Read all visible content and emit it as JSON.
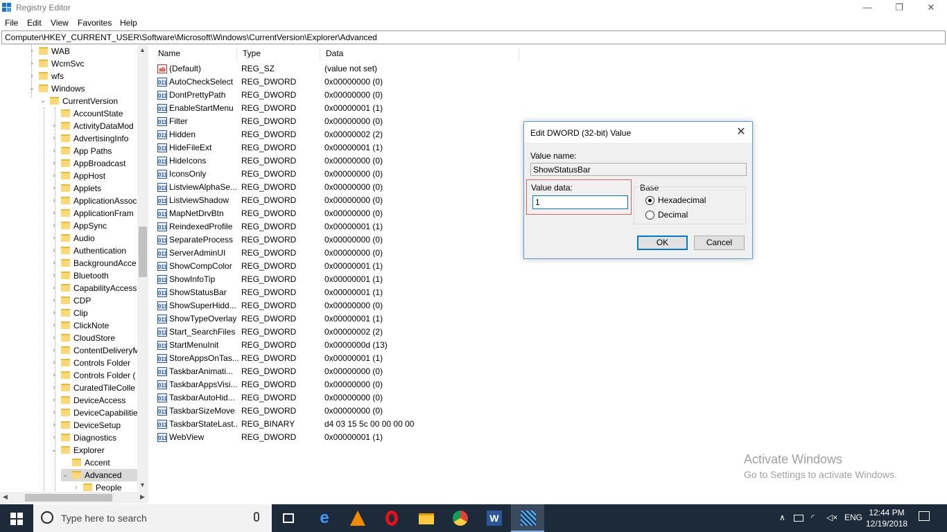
{
  "window": {
    "title": "Registry Editor",
    "min": "—",
    "max": "❐",
    "close": "✕"
  },
  "menu": [
    "File",
    "Edit",
    "View",
    "Favorites",
    "Help"
  ],
  "address": "Computer\\HKEY_CURRENT_USER\\Software\\Microsoft\\Windows\\CurrentVersion\\Explorer\\Advanced",
  "tree": {
    "items": [
      {
        "label": "WAB",
        "exp": "›"
      },
      {
        "label": "WcmSvc",
        "exp": "›"
      },
      {
        "label": "wfs",
        "exp": "›"
      },
      {
        "label": "Windows",
        "exp": "⌄"
      },
      {
        "label": "CurrentVersion",
        "exp": "⌄"
      },
      {
        "label": "AccountState",
        "exp": ""
      },
      {
        "label": "ActivityDataMod",
        "exp": "›"
      },
      {
        "label": "AdvertisingInfo",
        "exp": "›"
      },
      {
        "label": "App Paths",
        "exp": "›"
      },
      {
        "label": "AppBroadcast",
        "exp": "›"
      },
      {
        "label": "AppHost",
        "exp": "›"
      },
      {
        "label": "Applets",
        "exp": "›"
      },
      {
        "label": "ApplicationAssoc",
        "exp": "›"
      },
      {
        "label": "ApplicationFram",
        "exp": "›"
      },
      {
        "label": "AppSync",
        "exp": "›"
      },
      {
        "label": "Audio",
        "exp": "›"
      },
      {
        "label": "Authentication",
        "exp": "›"
      },
      {
        "label": "BackgroundAcce",
        "exp": "›"
      },
      {
        "label": "Bluetooth",
        "exp": "›"
      },
      {
        "label": "CapabilityAccess",
        "exp": "›"
      },
      {
        "label": "CDP",
        "exp": "›"
      },
      {
        "label": "Clip",
        "exp": "›"
      },
      {
        "label": "ClickNote",
        "exp": "›"
      },
      {
        "label": "CloudStore",
        "exp": "›"
      },
      {
        "label": "ContentDeliveryM",
        "exp": "›"
      },
      {
        "label": "Controls Folder",
        "exp": "›"
      },
      {
        "label": "Controls Folder (",
        "exp": "›"
      },
      {
        "label": "CuratedTileColle",
        "exp": "›"
      },
      {
        "label": "DeviceAccess",
        "exp": "›"
      },
      {
        "label": "DeviceCapabilitie",
        "exp": "›"
      },
      {
        "label": "DeviceSetup",
        "exp": "›"
      },
      {
        "label": "Diagnostics",
        "exp": "›"
      },
      {
        "label": "Explorer",
        "exp": "⌄"
      },
      {
        "label": "Accent",
        "exp": ""
      },
      {
        "label": "Advanced",
        "exp": "⌄"
      },
      {
        "label": "People",
        "exp": "›"
      }
    ]
  },
  "list": {
    "columns": [
      "Name",
      "Type",
      "Data"
    ],
    "rows": [
      {
        "name": "(Default)",
        "type": "REG_SZ",
        "data": "(value not set)",
        "icon": "sz"
      },
      {
        "name": "AutoCheckSelect",
        "type": "REG_DWORD",
        "data": "0x00000000 (0)",
        "icon": "dword"
      },
      {
        "name": "DontPrettyPath",
        "type": "REG_DWORD",
        "data": "0x00000000 (0)",
        "icon": "dword"
      },
      {
        "name": "EnableStartMenu",
        "type": "REG_DWORD",
        "data": "0x00000001 (1)",
        "icon": "dword"
      },
      {
        "name": "Filter",
        "type": "REG_DWORD",
        "data": "0x00000000 (0)",
        "icon": "dword"
      },
      {
        "name": "Hidden",
        "type": "REG_DWORD",
        "data": "0x00000002 (2)",
        "icon": "dword"
      },
      {
        "name": "HideFileExt",
        "type": "REG_DWORD",
        "data": "0x00000001 (1)",
        "icon": "dword"
      },
      {
        "name": "HideIcons",
        "type": "REG_DWORD",
        "data": "0x00000000 (0)",
        "icon": "dword"
      },
      {
        "name": "IconsOnly",
        "type": "REG_DWORD",
        "data": "0x00000000 (0)",
        "icon": "dword"
      },
      {
        "name": "ListviewAlphaSe...",
        "type": "REG_DWORD",
        "data": "0x00000000 (0)",
        "icon": "dword"
      },
      {
        "name": "ListviewShadow",
        "type": "REG_DWORD",
        "data": "0x00000000 (0)",
        "icon": "dword"
      },
      {
        "name": "MapNetDrvBtn",
        "type": "REG_DWORD",
        "data": "0x00000000 (0)",
        "icon": "dword"
      },
      {
        "name": "ReindexedProfile",
        "type": "REG_DWORD",
        "data": "0x00000001 (1)",
        "icon": "dword"
      },
      {
        "name": "SeparateProcess",
        "type": "REG_DWORD",
        "data": "0x00000000 (0)",
        "icon": "dword"
      },
      {
        "name": "ServerAdminUI",
        "type": "REG_DWORD",
        "data": "0x00000000 (0)",
        "icon": "dword"
      },
      {
        "name": "ShowCompColor",
        "type": "REG_DWORD",
        "data": "0x00000001 (1)",
        "icon": "dword"
      },
      {
        "name": "ShowInfoTip",
        "type": "REG_DWORD",
        "data": "0x00000001 (1)",
        "icon": "dword"
      },
      {
        "name": "ShowStatusBar",
        "type": "REG_DWORD",
        "data": "0x00000001 (1)",
        "icon": "dword"
      },
      {
        "name": "ShowSuperHidd...",
        "type": "REG_DWORD",
        "data": "0x00000000 (0)",
        "icon": "dword"
      },
      {
        "name": "ShowTypeOverlay",
        "type": "REG_DWORD",
        "data": "0x00000001 (1)",
        "icon": "dword"
      },
      {
        "name": "Start_SearchFiles",
        "type": "REG_DWORD",
        "data": "0x00000002 (2)",
        "icon": "dword"
      },
      {
        "name": "StartMenuInit",
        "type": "REG_DWORD",
        "data": "0x0000000d (13)",
        "icon": "dword"
      },
      {
        "name": "StoreAppsOnTas...",
        "type": "REG_DWORD",
        "data": "0x00000001 (1)",
        "icon": "dword"
      },
      {
        "name": "TaskbarAnimati...",
        "type": "REG_DWORD",
        "data": "0x00000000 (0)",
        "icon": "dword"
      },
      {
        "name": "TaskbarAppsVisi...",
        "type": "REG_DWORD",
        "data": "0x00000000 (0)",
        "icon": "dword"
      },
      {
        "name": "TaskbarAutoHid...",
        "type": "REG_DWORD",
        "data": "0x00000000 (0)",
        "icon": "dword"
      },
      {
        "name": "TaskbarSizeMove",
        "type": "REG_DWORD",
        "data": "0x00000000 (0)",
        "icon": "dword"
      },
      {
        "name": "TaskbarStateLast...",
        "type": "REG_BINARY",
        "data": "d4 03 15 5c 00 00 00 00",
        "icon": "dword"
      },
      {
        "name": "WebView",
        "type": "REG_DWORD",
        "data": "0x00000001 (1)",
        "icon": "dword"
      }
    ]
  },
  "dialog": {
    "title": "Edit DWORD (32-bit) Value",
    "value_name_label": "Value name:",
    "value_name": "ShowStatusBar",
    "value_data_label": "Value data:",
    "value_data": "1",
    "base_label": "Base",
    "hex_label": "Hexadecimal",
    "dec_label": "Decimal",
    "base_selected": "Hexadecimal",
    "ok": "OK",
    "cancel": "Cancel"
  },
  "watermark": {
    "line1": "Activate Windows",
    "line2": "Go to Settings to activate Windows."
  },
  "taskbar": {
    "search_placeholder": "Type here to search",
    "lang": "ENG",
    "time": "12:44 PM",
    "date": "12/19/2018"
  }
}
